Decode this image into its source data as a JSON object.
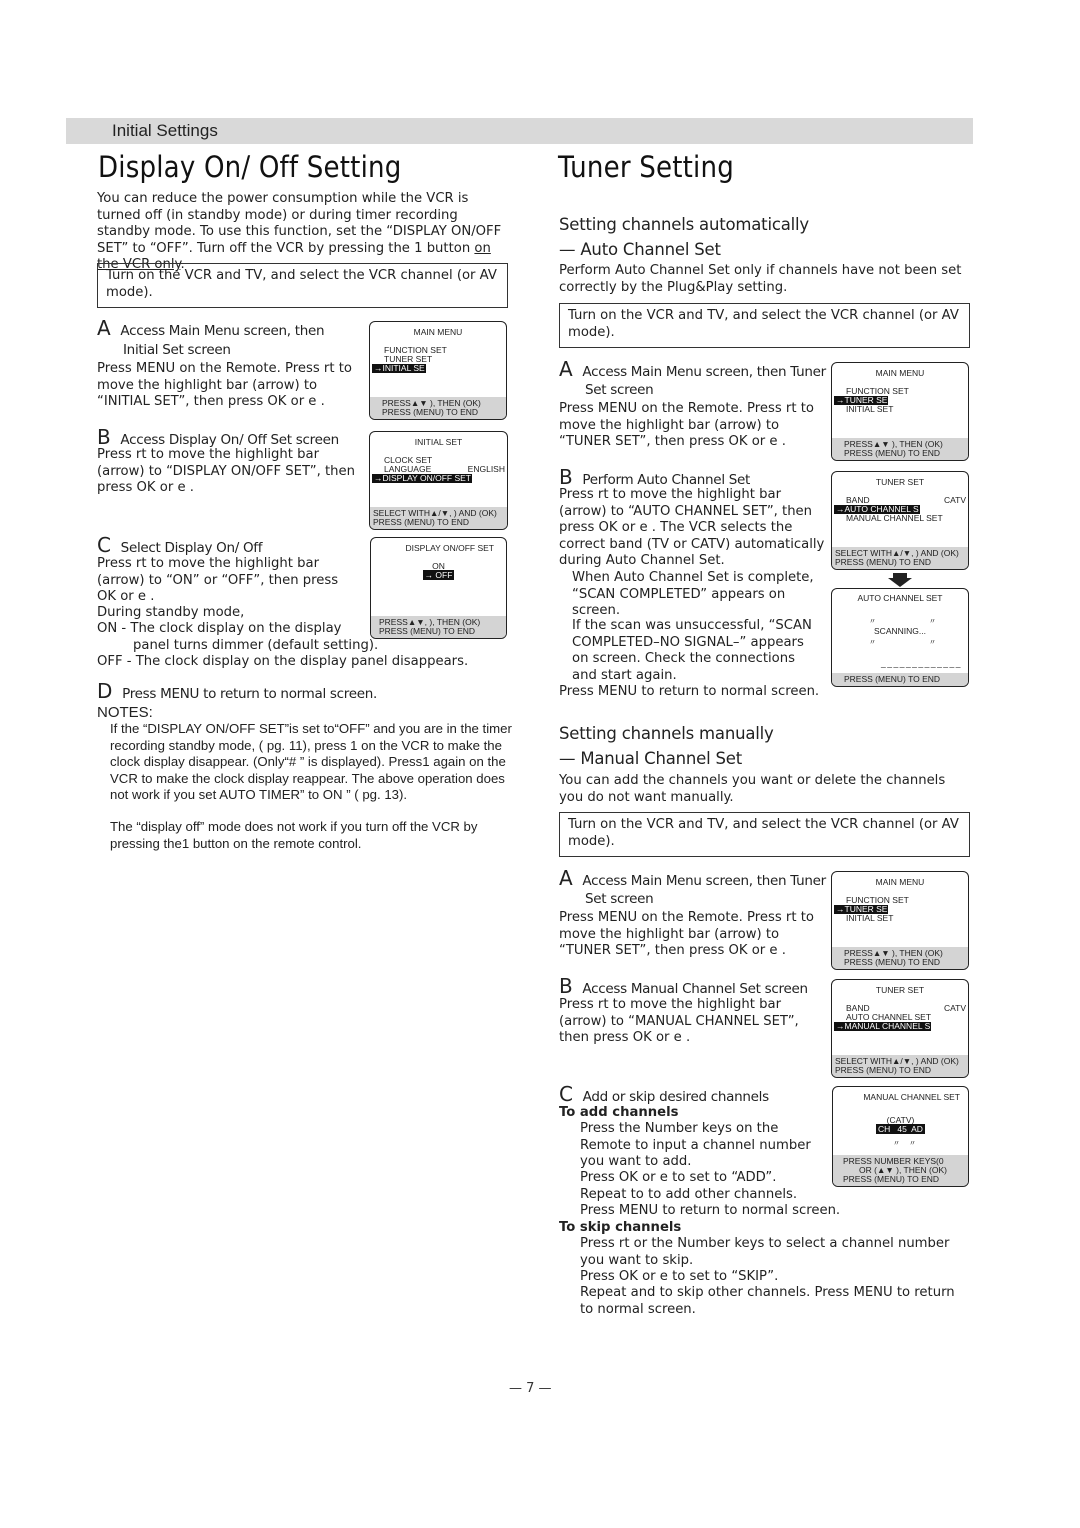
{
  "header": {
    "section": "Initial Settings"
  },
  "left": {
    "title": "Display On/ Off Setting",
    "intro": "You can reduce the power consumption while the VCR is turned off (in standby mode) or during timer recording standby mode. To use this function, set the “DISPLAY ON/OFF SET” to “OFF”. Turn off the VCR by pressing the 1   button ",
    "intro_underlined": "on the VCR only",
    "intro_end": ".",
    "prereq": "Turn on the VCR and TV, and select the VCR channel (or AV mode).",
    "steps": [
      {
        "letter": "A",
        "title": "Access Main Menu screen, then",
        "title2": "Initial Set screen",
        "text": "Press MENU on the Remote. Press rt    to move the highlight bar (arrow) to “INITIAL SET”, then press OK or e ."
      },
      {
        "letter": "B",
        "title": "Access Display On/ Off Set screen",
        "text": "Press rt    to move the highlight bar (arrow) to “DISPLAY ON/OFF SET”, then press OK or e ."
      },
      {
        "letter": "C",
        "title": "Select Display On/ Off",
        "text": "Press rt    to move the highlight bar (arrow) to “ON” or “OFF”, then press OK or e .",
        "standby": "During standby mode,",
        "on_line1": "ON - The clock display on the display",
        "on_line2": "panel turns dimmer (default setting).",
        "off_line": "OFF - The clock display on the display panel disappears."
      },
      {
        "letter": "D",
        "title": "Press MENU to return to normal screen."
      }
    ],
    "notes_title": "NOTES:",
    "notes": [
      "If the “DISPLAY ON/OFF SET”is set to“OFF” and you are in the timer recording standby mode, (    pg. 11), press 1   on the VCR to make the clock display disappear. (Only“# ” is displayed). Press1    again on the VCR to make the clock display reappear. The above operation does not work if you set  AUTO TIMER” to  ON ” (    pg. 13).",
      "The “display off” mode does not work if you turn off the VCR by pressing the1    button on the remote control."
    ],
    "screens": {
      "main_menu": {
        "title": "MAIN MENU",
        "items": [
          "FUNCTION SET",
          "TUNER SET",
          "→INITIAL SE"
        ],
        "selected": 2,
        "footer": [
          "PRESS▲▼  ), THEN (OK)",
          "PRESS (MENU) TO END"
        ]
      },
      "initial_set": {
        "title": "INITIAL SET",
        "items": [
          "CLOCK SET",
          "LANGUAGE",
          "→DISPLAY  ON/OFF  SET"
        ],
        "language_value": "ENGLISH",
        "selected": 2,
        "footer": [
          "SELECT WITH▲/▼,   ) AND (OK)",
          "PRESS (MENU) TO END"
        ]
      },
      "display_onoff": {
        "title": "DISPLAY ON/OFF SET",
        "items": [
          "ON",
          "→ OFF"
        ],
        "selected": 1,
        "footer": [
          "PRESS▲▼,   ), THEN (OK)",
          "PRESS (MENU) TO END"
        ]
      }
    }
  },
  "right": {
    "title": "Tuner Setting",
    "auto": {
      "heading1": "Setting channels automatically",
      "heading2": "— Auto Channel Set",
      "intro": "Perform Auto Channel Set only if channels have not been set correctly by the Plug&Play setting.",
      "prereq": "Turn on the VCR and TV, and select the VCR channel (or AV mode).",
      "stepA_title": "Access Main Menu screen, then Tuner",
      "stepA_title2": "Set screen",
      "stepA_text": "Press MENU on the Remote. Press rt    to move the highlight bar (arrow) to “TUNER SET”, then press OK or e .",
      "stepB_title": "Perform Auto Channel Set",
      "stepB_text": "Press rt    to move the highlight bar (arrow) to “AUTO CHANNEL SET”, then press OK or e . The VCR selects the correct band (TV or CATV) automatically during Auto Channel Set.",
      "complete": "When Auto Channel Set is complete, “SCAN COMPLETED” appears on screen.",
      "unsuccessful": "If the scan was unsuccessful, “SCAN COMPLETED–NO SIGNAL–” appears on screen. Check the connections and start again.",
      "return": "Press MENU to return to normal screen."
    },
    "manual": {
      "heading1": "Setting channels manually",
      "heading2": "— Manual Channel Set",
      "intro": "You can add the channels you want or delete the channels you do not want manually.",
      "prereq": "Turn on the VCR and TV, and select the VCR channel (or AV mode).",
      "stepA_title": "Access Main Menu screen, then Tuner",
      "stepA_title2": "Set screen",
      "stepA_text": "Press MENU on the Remote. Press rt    to move the highlight bar (arrow) to “TUNER SET”, then press OK or e .",
      "stepB_title": "Access Manual Channel Set screen",
      "stepB_text": "Press rt    to move the highlight bar (arrow) to “MANUAL CHANNEL SET”, then press OK or e .",
      "stepC_title": "Add or skip desired channels",
      "add_title": "To add channels",
      "add_lines": [
        "Press the Number keys on the Remote to input a channel number you want to add.",
        "Press OK or e  to set to “ADD”.",
        "Repeat    to    to add other channels.",
        "Press MENU to return to normal screen."
      ],
      "skip_title": "To skip channels",
      "skip_lines": [
        "Press rt    or the Number keys to select a channel number you want to skip.",
        "Press OK or e  to set to “SKIP”.",
        "Repeat    and    to skip other channels. Press MENU to return to normal screen."
      ]
    },
    "screens": {
      "main_menu_auto": {
        "title": "MAIN MENU",
        "items": [
          "FUNCTION SET",
          "→TUNER SE",
          "INITIAL SET"
        ],
        "selected": 1,
        "footer": [
          "PRESS▲▼  ), THEN (OK)",
          "PRESS (MENU) TO END"
        ]
      },
      "tuner_set_auto": {
        "title": "TUNER SET",
        "items": [
          "BAND",
          "→AUTO CHANNEL S",
          "MANUAL CHANNEL SET"
        ],
        "band_value": "CATV",
        "selected": 1,
        "footer": [
          "SELECT WITH▲/▼,   ) AND (OK)",
          "PRESS (MENU) TO END"
        ]
      },
      "auto_channel_set": {
        "title": "AUTO CHANNEL SET",
        "status": "SCANNING...",
        "progress": "_____________",
        "footer": [
          "PRESS (MENU) TO END"
        ]
      },
      "main_menu_manual": {
        "title": "MAIN MENU",
        "items": [
          "FUNCTION SET",
          "→TUNER SE",
          "INITIAL SET"
        ],
        "selected": 1,
        "footer": [
          "PRESS▲▼  ), THEN (OK)",
          "PRESS (MENU) TO END"
        ]
      },
      "tuner_set_manual": {
        "title": "TUNER SET",
        "items": [
          "BAND",
          "AUTO CHANNEL SET",
          "→MANUAL CHANNEL S"
        ],
        "band_value": "CATV",
        "selected": 2,
        "footer": [
          "SELECT WITH▲/▼,   ) AND (OK)",
          "PRESS (MENU) TO END"
        ]
      },
      "manual_channel_set": {
        "title": "MANUAL CHANNEL SET",
        "band": "(CATV)",
        "channel_row": "CH   45  AD",
        "footer": [
          "PRESS NUMBER KEYS(0",
          "OR (▲▼ ), THEN (OK)",
          "PRESS (MENU) TO END"
        ]
      }
    }
  },
  "footer": {
    "page_number": "— 7 —"
  }
}
